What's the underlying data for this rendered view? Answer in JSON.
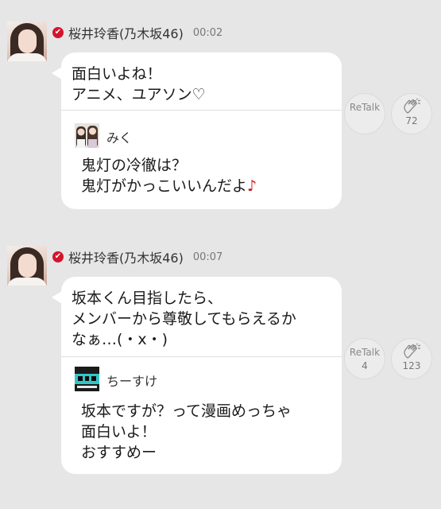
{
  "posts": [
    {
      "author": "桜井玲香(乃木坂46)",
      "time": "00:02",
      "message": "面白いよね！\nアニメ、ユアソン♡",
      "quote": {
        "user": "みく",
        "text_main": "鬼灯の冷徹は？\n鬼灯がかっこいいんだよ",
        "text_note": "♪"
      },
      "retalk_label": "ReTalk",
      "retalk_count": "",
      "clap_count": "72"
    },
    {
      "author": "桜井玲香(乃木坂46)",
      "time": "00:07",
      "message": "坂本くん目指したら、\nメンバーから尊敬してもらえるか\nなぁ…(・x・)",
      "quote": {
        "user": "ちーすけ",
        "text_main": "坂本ですが？って漫画めっちゃ\n面白いよ！\nおすすめー",
        "text_note": ""
      },
      "retalk_label": "ReTalk",
      "retalk_count": "4",
      "clap_count": "123"
    }
  ],
  "colors": {
    "background": "#e6e6e6",
    "verified": "#d3142c",
    "note": "#d11a1a"
  },
  "icons": {
    "verified": "✔",
    "clap": "clap-icon"
  }
}
